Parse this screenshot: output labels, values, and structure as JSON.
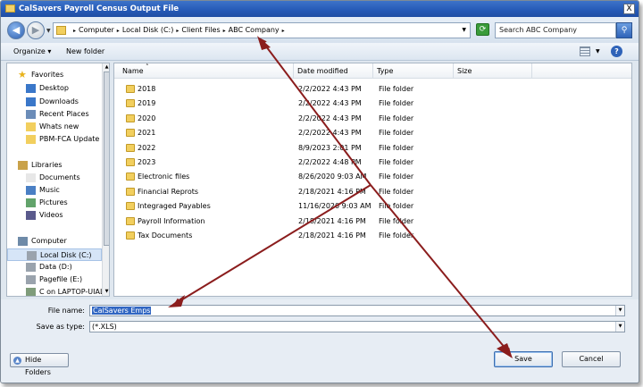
{
  "window": {
    "title": "CalSavers Payroll Census Output File",
    "close_glyph": "X"
  },
  "address": {
    "crumbs": [
      "Computer",
      "Local Disk (C:)",
      "Client Files",
      "ABC Company"
    ],
    "separator": "▸",
    "search_placeholder": "Search ABC Company"
  },
  "toolbar": {
    "organize": "Organize ▾",
    "new_folder": "New folder",
    "help": "?"
  },
  "nav": {
    "items": [
      {
        "label": "Favorites",
        "icon": "star-icon",
        "indent": 0
      },
      {
        "label": "Desktop",
        "icon": "desktop-icon",
        "indent": 1
      },
      {
        "label": "Downloads",
        "icon": "downloads-icon",
        "indent": 1
      },
      {
        "label": "Recent Places",
        "icon": "recent-places-icon",
        "indent": 1
      },
      {
        "label": "Whats new",
        "icon": "folder-icon",
        "indent": 1
      },
      {
        "label": "PBM-FCA Update",
        "icon": "folder-icon",
        "indent": 1
      },
      {
        "label": "Libraries",
        "icon": "libraries-icon",
        "indent": 0
      },
      {
        "label": "Documents",
        "icon": "documents-icon",
        "indent": 1
      },
      {
        "label": "Music",
        "icon": "music-icon",
        "indent": 1
      },
      {
        "label": "Pictures",
        "icon": "pictures-icon",
        "indent": 1
      },
      {
        "label": "Videos",
        "icon": "videos-icon",
        "indent": 1
      },
      {
        "label": "Computer",
        "icon": "computer-icon",
        "indent": 0
      },
      {
        "label": "Local Disk (C:)",
        "icon": "drive-icon",
        "indent": 1,
        "selected": true
      },
      {
        "label": "Data (D:)",
        "icon": "drive-icon",
        "indent": 1
      },
      {
        "label": "Pagefile (E:)",
        "icon": "drive-icon",
        "indent": 1
      },
      {
        "label": "C on LAPTOP-UIAL",
        "icon": "network-drive-icon",
        "indent": 1
      }
    ]
  },
  "columns": {
    "name": "Name",
    "sort_glyph": "˄",
    "date": "Date modified",
    "type": "Type",
    "size": "Size"
  },
  "files": [
    {
      "name": "2018",
      "date": "2/2/2022 4:43 PM",
      "type": "File folder"
    },
    {
      "name": "2019",
      "date": "2/2/2022 4:43 PM",
      "type": "File folder"
    },
    {
      "name": "2020",
      "date": "2/2/2022 4:43 PM",
      "type": "File folder"
    },
    {
      "name": "2021",
      "date": "2/2/2022 4:43 PM",
      "type": "File folder"
    },
    {
      "name": "2022",
      "date": "8/9/2023 2:01 PM",
      "type": "File folder"
    },
    {
      "name": "2023",
      "date": "2/2/2022 4:48 PM",
      "type": "File folder"
    },
    {
      "name": "Electronic files",
      "date": "8/26/2020 9:03 AM",
      "type": "File folder"
    },
    {
      "name": "Financial Reprots",
      "date": "2/18/2021 4:16 PM",
      "type": "File folder"
    },
    {
      "name": "Integraged Payables",
      "date": "11/16/2020 9:03 AM",
      "type": "File folder"
    },
    {
      "name": "Payroll Information",
      "date": "2/18/2021 4:16 PM",
      "type": "File folder"
    },
    {
      "name": "Tax Documents",
      "date": "2/18/2021 4:16 PM",
      "type": "File folder"
    }
  ],
  "form": {
    "file_name_label": "File name:",
    "file_name_value": "CalSavers Emps",
    "save_type_label": "Save as type:",
    "save_type_value": "(*.XLS)"
  },
  "buttons": {
    "hide_folders": "Hide Folders",
    "save": "Save",
    "cancel": "Cancel"
  },
  "colors": {
    "annotation_arrow": "#8b1d1d",
    "title_bar": "#2559b6",
    "selection": "#3166c2"
  }
}
